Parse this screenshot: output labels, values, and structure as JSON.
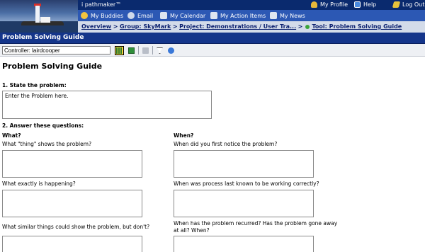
{
  "header": {
    "brand": "i pathmaker™",
    "links": [
      {
        "label": "My Profile",
        "icon": "person-icon",
        "color": "#e8b83a"
      },
      {
        "label": "Help",
        "icon": "help-icon",
        "color": "#4a8be0"
      },
      {
        "label": "Log Out",
        "icon": "logout-icon",
        "color": "#e8c33a"
      }
    ],
    "nav": [
      {
        "label": "My Buddies",
        "icon": "smiley-icon",
        "color": "#f2c440"
      },
      {
        "label": "Email",
        "icon": "email-icon",
        "color": "#cfd9ea"
      },
      {
        "label": "My Calendar",
        "icon": "calendar-icon",
        "color": "#dfe6f0"
      },
      {
        "label": "My Action Items",
        "icon": "action-items-icon",
        "color": "#dfe6f0"
      },
      {
        "label": "My News",
        "icon": "news-icon",
        "color": "#dfe6f0"
      }
    ],
    "breadcrumb": {
      "overview": "Overview",
      "group": "Group: SkyMark",
      "project": "Project: Demonstrations / User Tra...",
      "tool": "Tool: Problem Solving Guide",
      "sep": ">"
    }
  },
  "titlebar": {
    "title": "Problem Solving Guide"
  },
  "toolbar": {
    "controller_value": "Controller: lairdcooper"
  },
  "main": {
    "heading": "Problem Solving Guide",
    "section1": {
      "label": "1. State the problem:",
      "value": "Enter the Problem here."
    },
    "section2": {
      "label": "2. Answer these questions:",
      "what": {
        "heading": "What?",
        "questions": [
          "What \"thing\" shows the problem?",
          "What exactly is happening?",
          "What similar things could show the problem, but don't?"
        ]
      },
      "when": {
        "heading": "When?",
        "questions": [
          "When did you first notice the problem?",
          "When was process last known to be working correctly?",
          "When has the problem recurred? Has the problem gone away at all? When?"
        ]
      }
    }
  },
  "colors": {
    "header_dark": "#0a2a6e",
    "nav_blue": "#2c58b4",
    "crumb_bg": "#d3dbe9",
    "titlebar": "#14358a",
    "link": "#0a1f6e"
  }
}
